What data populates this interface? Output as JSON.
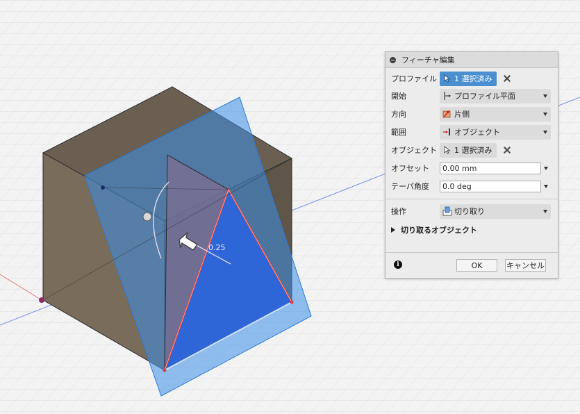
{
  "viewport": {
    "dimension_label": "0.25"
  },
  "dialog": {
    "title": "フィーチャ編集",
    "profile": {
      "label": "プロファイル",
      "value": "1 選択済み"
    },
    "start": {
      "label": "開始",
      "value": "プロファイル平面"
    },
    "direction": {
      "label": "方向",
      "value": "片側"
    },
    "extent": {
      "label": "範囲",
      "value": "オブジェクト"
    },
    "object": {
      "label": "オブジェクト",
      "value": "1 選択済み"
    },
    "offset": {
      "label": "オフセット",
      "value": "0.00 mm"
    },
    "taper": {
      "label": "テーパ角度",
      "value": "0.0 deg"
    },
    "operation": {
      "label": "操作",
      "value": "切り取り"
    },
    "objects_to_cut": {
      "label": "切り取るオブジェクト"
    },
    "ok_label": "OK",
    "cancel_label": "キャンセル"
  },
  "colors": {
    "accent": "#4a90d0",
    "box_face": "#7a6c5a",
    "plane": "#3a8ee8",
    "edge_highlight": "#e03a3a"
  }
}
